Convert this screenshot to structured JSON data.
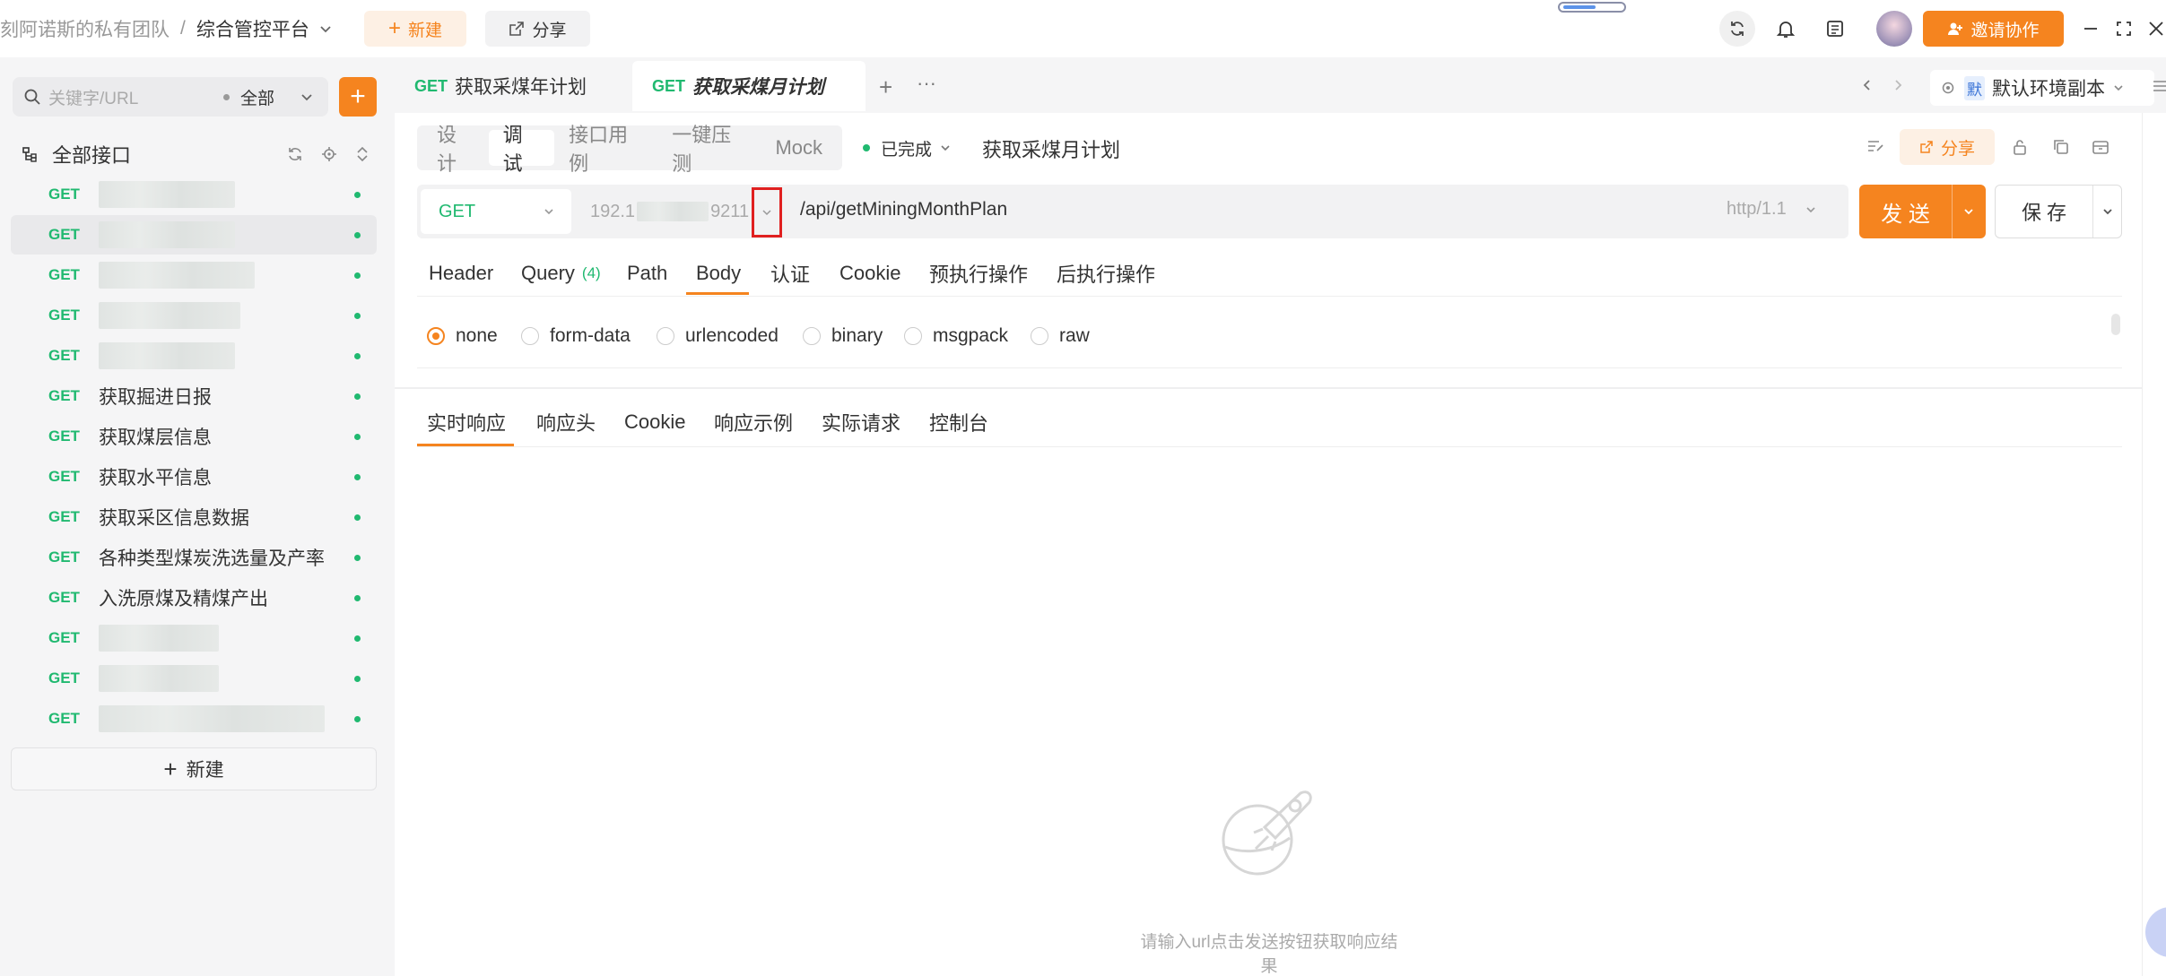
{
  "titlebar": {
    "team": "刻阿诺斯的私有团队",
    "separator": "/",
    "project": "综合管控平台",
    "new_label": "新建",
    "share_label": "分享",
    "invite_label": "邀请协作"
  },
  "sidebar": {
    "search_placeholder": "关键字/URL",
    "filter_label": "全部",
    "header_title": "全部接口",
    "new_label": "新建",
    "items": [
      {
        "method": "GET",
        "name": ""
      },
      {
        "method": "GET",
        "name": ""
      },
      {
        "method": "GET",
        "name": ""
      },
      {
        "method": "GET",
        "name": ""
      },
      {
        "method": "GET",
        "name": ""
      },
      {
        "method": "GET",
        "name": "获取掘进日报"
      },
      {
        "method": "GET",
        "name": "获取煤层信息"
      },
      {
        "method": "GET",
        "name": "获取水平信息"
      },
      {
        "method": "GET",
        "name": "获取采区信息数据"
      },
      {
        "method": "GET",
        "name": "各种类型煤炭洗选量及产率"
      },
      {
        "method": "GET",
        "name": "入洗原煤及精煤产出"
      },
      {
        "method": "GET",
        "name": ""
      },
      {
        "method": "GET",
        "name": ""
      },
      {
        "method": "GET",
        "name": ""
      }
    ]
  },
  "tabs": [
    {
      "method": "GET",
      "name": "获取采煤年计划"
    },
    {
      "method": "GET",
      "name": "获取采煤月计划"
    }
  ],
  "env": {
    "badge": "默",
    "name": "默认环境副本"
  },
  "modes": [
    "设计",
    "调试",
    "接口用例",
    "一键压测",
    "Mock"
  ],
  "status": "已完成",
  "api_title": "获取采煤月计划",
  "toolbar_share": "分享",
  "request": {
    "method": "GET",
    "host": "192.1",
    "host_tail": "9211",
    "path": "/api/getMiningMonthPlan",
    "protocol": "http/1.1",
    "send_label": "发 送",
    "save_label": "保 存"
  },
  "param_tabs": {
    "header": "Header",
    "query": "Query",
    "query_count": "(4)",
    "path": "Path",
    "body": "Body",
    "auth": "认证",
    "cookie": "Cookie",
    "pre": "预执行操作",
    "post": "后执行操作"
  },
  "body_types": [
    "none",
    "form-data",
    "urlencoded",
    "binary",
    "msgpack",
    "raw"
  ],
  "response_tabs": [
    "实时响应",
    "响应头",
    "Cookie",
    "响应示例",
    "实际请求",
    "控制台"
  ],
  "empty_hint": "请输入url点击发送按钮获取响应结果",
  "colors": {
    "accent": "#f5841f",
    "get": "#20b970",
    "sidebar_bg": "#f5f5f6"
  }
}
